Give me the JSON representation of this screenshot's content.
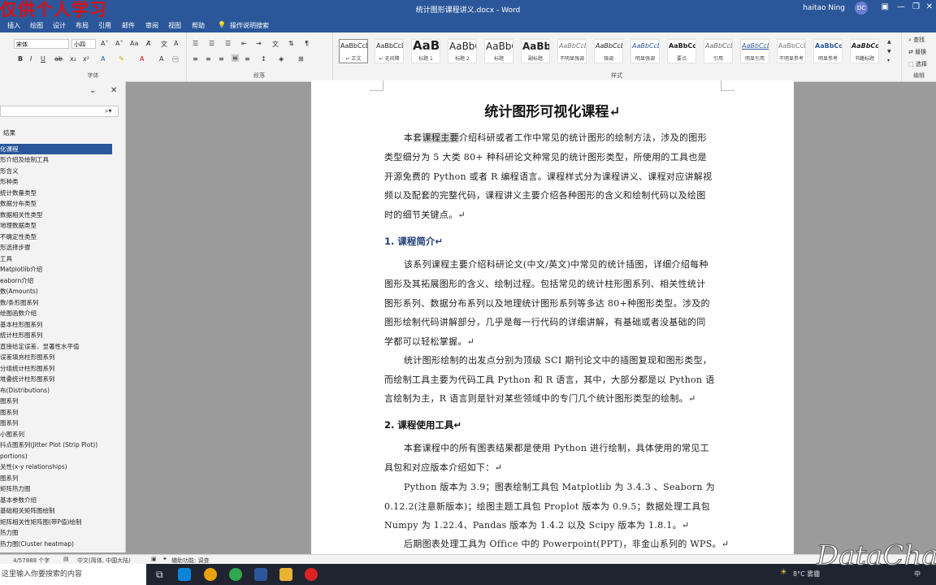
{
  "titlebar": {
    "watermark": "仅供个人学习",
    "doc_title": "统计图形课程讲义.docx - Word",
    "user": "haitao Ning",
    "avatar": "DC"
  },
  "tabs": [
    "插入",
    "绘图",
    "设计",
    "布局",
    "引用",
    "邮件",
    "审阅",
    "视图",
    "帮助",
    "操作说明搜索"
  ],
  "ribbon": {
    "font_name": "宋体",
    "font_size": "小四",
    "group_font": "字体",
    "group_paragraph": "段落",
    "group_styles": "样式",
    "group_edit": "编辑",
    "styles": [
      {
        "preview": "AaBbCcDd",
        "name": "↵ 正文"
      },
      {
        "preview": "AaBbCcDd",
        "name": "↵ 无间隔"
      },
      {
        "preview": "AaBl",
        "name": "标题 1"
      },
      {
        "preview": "AaBbC",
        "name": "标题 2"
      },
      {
        "preview": "AaBbC",
        "name": "标题"
      },
      {
        "preview": "AaBbC",
        "name": "副标题"
      },
      {
        "preview": "AaBbCcDd",
        "name": "不明显强调"
      },
      {
        "preview": "AaBbCcDd",
        "name": "强调"
      },
      {
        "preview": "AaBbCcDd",
        "name": "明显强调"
      },
      {
        "preview": "AaBbCcD",
        "name": "要点"
      },
      {
        "preview": "AaBbCcDd",
        "name": "引用"
      },
      {
        "preview": "AaBbCcDd",
        "name": "明显引用"
      },
      {
        "preview": "AaBbCcDd",
        "name": "不明显参考"
      },
      {
        "preview": "AaBbCcD",
        "name": "明显参考"
      },
      {
        "preview": "AaBbCcD",
        "name": "书籍标题"
      }
    ],
    "edit": [
      "查找",
      "替换",
      "选择"
    ]
  },
  "nav": {
    "results_label": "结果",
    "items": [
      "化课程",
      "形介绍及绘制工具",
      "形含义",
      "形种类",
      "统计数量类型",
      "数据分布类型",
      "数据相关性类型",
      "地理数据类型",
      "不确定性类型",
      "形选择步骤",
      "工具",
      "Matplotlib介绍",
      "eaborn介绍",
      "数(Amounts)",
      "数/条形图系列",
      "绘图函数介绍",
      "基本柱形图系列",
      "统计柱形图系列",
      "直接给定误差、显著性水平值",
      "误差填充柱形图系列",
      "分组统计柱形图系列",
      "堆叠统计柱形图系列",
      "布(Distributions)",
      "图系列",
      "图系列",
      "图系列",
      "小图系列",
      "抖点图系列(Jitter Plot (Strip Plot))",
      "portions)",
      "关性(x-y relationships)",
      "图系列",
      "矩阵热力图",
      "基本参数介绍",
      "基础相关矩阵图绘制",
      "矩阵相关性矩阵图(带P值)绘制",
      "热力图",
      "热力图(Cluster heatmap)"
    ]
  },
  "document": {
    "title": "统计图形可视化课程↵",
    "intro": [
      [
        "本套",
        "课程主要",
        "介绍科研或者工作中常见的统计图形的绘制方法，涉及的图形"
      ],
      "类型细分为 5 大类 80+ 种科研论文种常见的统计图形类型，所使用的工具也是",
      "开源免费的 Python 或者 R 编程语言。课程样式分为课程讲义、课程对应讲解视",
      "频以及配套的完整代码，课程讲义主要介绍各种图形的含义和绘制代码以及绘图",
      "时的细节关键点。↵"
    ],
    "h1": "1.  课程简介↵",
    "p1": [
      "该系列课程主要介绍科研论文(中文/英文)中常见的统计插图，详细介绍每种",
      "图形及其拓展图形的含义、绘制过程。包括常见的统计柱形图系列、相关性统计",
      "图形系列、数据分布系列以及地理统计图形系列等多达 80+种图形类型。涉及的",
      "图形绘制代码讲解部分，几乎是每一行代码的详细讲解，有基础或者没基础的同",
      "学都可以轻松掌握。↵"
    ],
    "p2": [
      "统计图形绘制的出发点分别为顶级 SCI 期刊论文中的插图复现和图形类型，",
      "而绘制工具主要为代码工具 Python 和 R 语言，其中，大部分都是以 Python 语",
      "言绘制为主，R 语言则是针对某些领域中的专门几个统计图形类型的绘制。↵"
    ],
    "h2": "2.  课程使用工具↵",
    "p3": [
      "本套课程中的所有图表结果都是使用 Python 进行绘制，具体使用的常见工",
      "具包和对应版本介绍如下：↵"
    ],
    "p4": [
      "Python 版本为 3.9；图表绘制工具包 Matplotlib 为 3.4.3 、Seaborn 为",
      "0.12.2(注意新版本)；绘图主题工具包 Proplot 版本为 0.9.5；数据处理工具包",
      "Numpy 为 1.22.4、Pandas 版本为 1.4.2 以及 Scipy 版本为 1.8.1。↵"
    ],
    "p5": "后期图表处理工具为 Office 中的 Powerpoint(PPT)，非金山系列的 WPS。↵"
  },
  "status": {
    "words": "4/57888 个字",
    "lang": "中文(简体, 中国大陆)",
    "access": "辅助功能: 调查"
  },
  "taskbar": {
    "search": "这里输入你要搜索的内容",
    "weather": "8°C 雾霾",
    "ime": "中"
  },
  "overlay_watermark": "DataCha"
}
